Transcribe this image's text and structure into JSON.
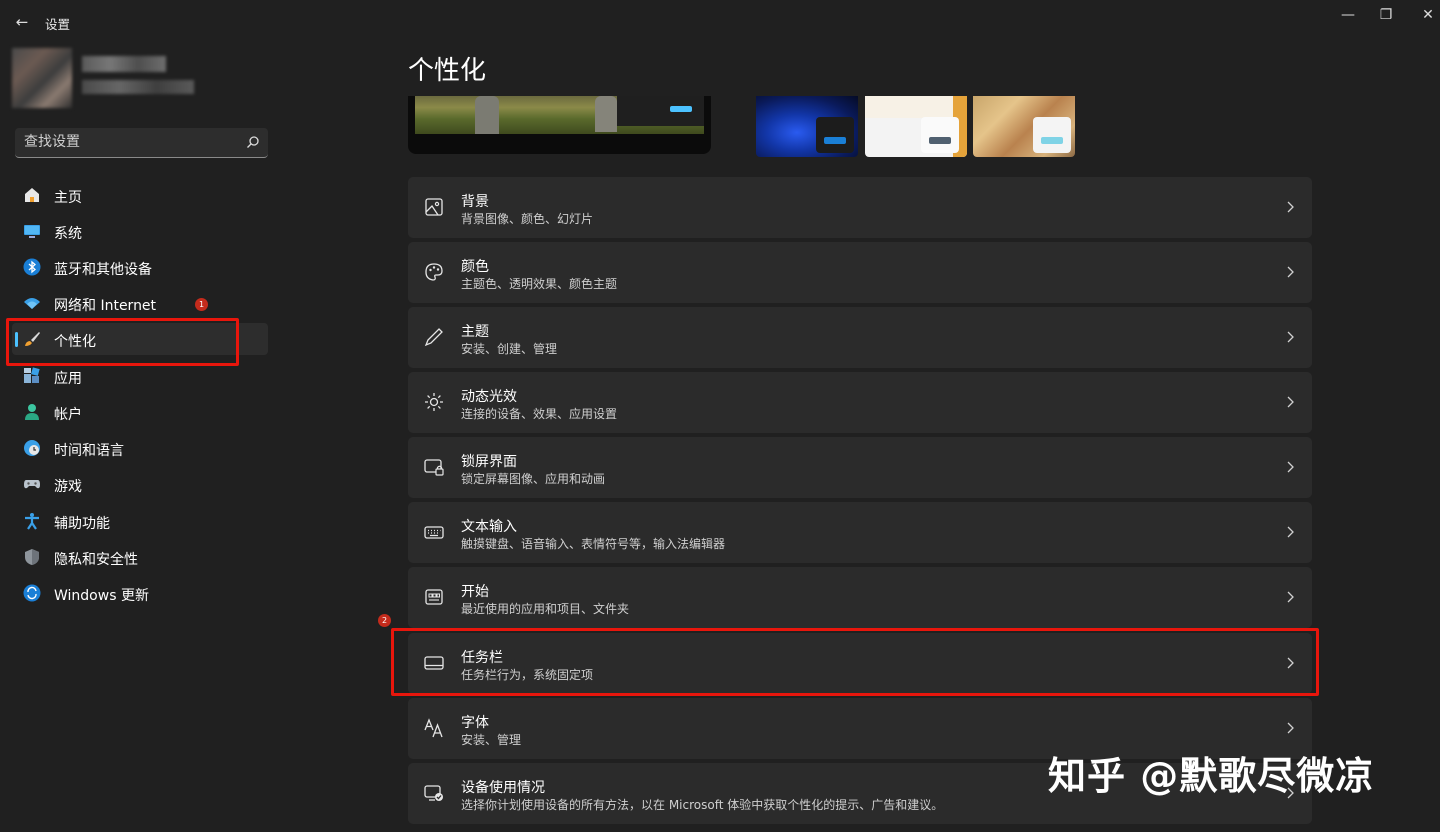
{
  "window": {
    "title": "设置",
    "minimize": "—",
    "restore": "❐",
    "close": "✕",
    "back": "←"
  },
  "search": {
    "placeholder": "查找设置"
  },
  "sidebar": {
    "items": [
      {
        "label": "主页",
        "icon": "home-icon"
      },
      {
        "label": "系统",
        "icon": "monitor-icon"
      },
      {
        "label": "蓝牙和其他设备",
        "icon": "bluetooth-icon"
      },
      {
        "label": "网络和 Internet",
        "icon": "wifi-icon"
      },
      {
        "label": "个性化",
        "icon": "brush-icon",
        "selected": true
      },
      {
        "label": "应用",
        "icon": "apps-icon"
      },
      {
        "label": "帐户",
        "icon": "user-icon"
      },
      {
        "label": "时间和语言",
        "icon": "globe-clock-icon"
      },
      {
        "label": "游戏",
        "icon": "gamepad-icon"
      },
      {
        "label": "辅助功能",
        "icon": "accessibility-icon"
      },
      {
        "label": "隐私和安全性",
        "icon": "shield-icon"
      },
      {
        "label": "Windows 更新",
        "icon": "update-icon"
      }
    ]
  },
  "annotations": {
    "step1": "1",
    "step2": "2"
  },
  "main": {
    "title": "个性化",
    "cards": [
      {
        "title": "背景",
        "subtitle": "背景图像、颜色、幻灯片",
        "icon": "image-icon"
      },
      {
        "title": "颜色",
        "subtitle": "主题色、透明效果、颜色主题",
        "icon": "palette-icon"
      },
      {
        "title": "主题",
        "subtitle": "安装、创建、管理",
        "icon": "pen-icon"
      },
      {
        "title": "动态光效",
        "subtitle": "连接的设备、效果、应用设置",
        "icon": "sparkle-icon"
      },
      {
        "title": "锁屏界面",
        "subtitle": "锁定屏幕图像、应用和动画",
        "icon": "lockscreen-icon"
      },
      {
        "title": "文本输入",
        "subtitle": "触摸键盘、语音输入、表情符号等，输入法编辑器",
        "icon": "keyboard-icon"
      },
      {
        "title": "开始",
        "subtitle": "最近使用的应用和项目、文件夹",
        "icon": "start-icon"
      },
      {
        "title": "任务栏",
        "subtitle": "任务栏行为，系统固定项",
        "icon": "taskbar-icon"
      },
      {
        "title": "字体",
        "subtitle": "安装、管理",
        "icon": "font-icon"
      },
      {
        "title": "设备使用情况",
        "subtitle": "选择你计划使用设备的所有方法，以在 Microsoft 体验中获取个性化的提示、广告和建议。",
        "icon": "device-usage-icon"
      }
    ]
  },
  "watermark": "知乎 @默歌尽微凉",
  "colors": {
    "accent": "#4cc2ff",
    "highlight": "#e8160c",
    "background": "#202020",
    "card": "#2b2b2b"
  }
}
